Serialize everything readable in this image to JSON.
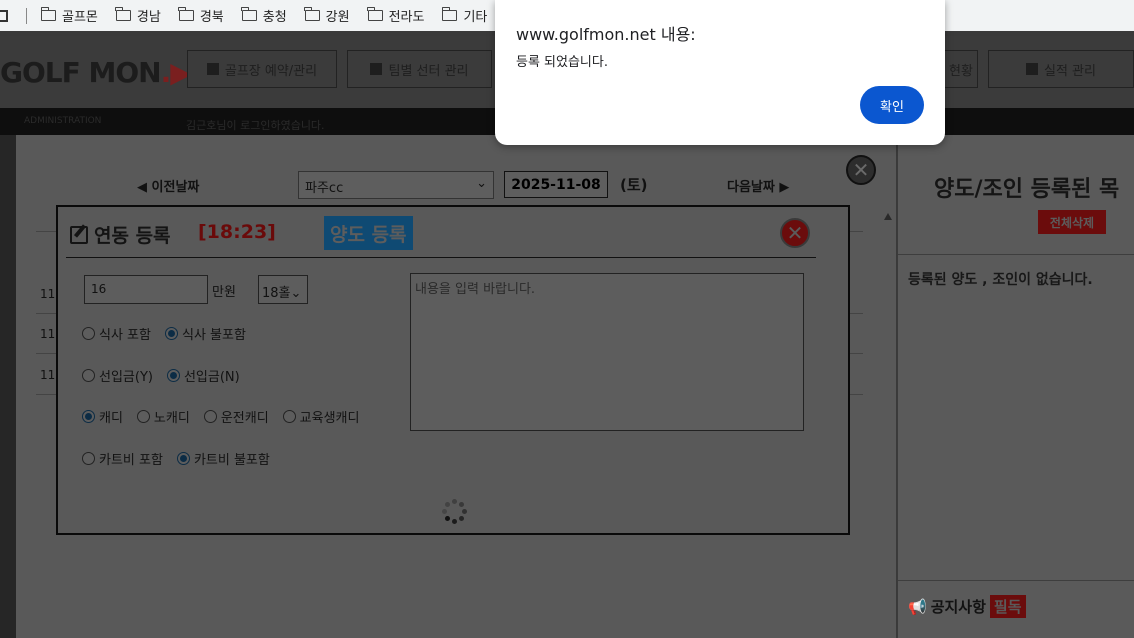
{
  "bookmarks": {
    "items": [
      "골프몬",
      "경남",
      "경북",
      "충청",
      "강원",
      "전라도",
      "기타"
    ]
  },
  "site": {
    "logo": "GOLF MON",
    "nav": [
      "골프장 예약/관리",
      "팀별 선터 관리",
      "현황",
      "실적 관리"
    ],
    "admin_label": "ADMINISTRATION",
    "login_text": "김근호님이 로그인하였습니다."
  },
  "panel": {
    "prev_label": "이전날짜",
    "course": "파주cc",
    "date": "2025-11-08",
    "weekday": "(토)",
    "next_label": "다음날짜",
    "rows": [
      "11",
      "11",
      "11"
    ]
  },
  "right_panel": {
    "title": "양도/조인 등록된 목",
    "delete_all": "전체삭제",
    "empty_text": "등록된 양도 , 조인이 없습니다.",
    "notice_label": "공지사항",
    "notice_badge": "필독"
  },
  "modal": {
    "title": "연동 등록",
    "time": "[18:23]",
    "tag": "양도 등록",
    "price_value": "16",
    "price_unit": "만원",
    "hole_option": "18홀",
    "meal": [
      "식사 포함",
      "식사 불포함"
    ],
    "deposit": [
      "선입금(Y)",
      "선입금(N)"
    ],
    "caddy": [
      "캐디",
      "노캐디",
      "운전캐디",
      "교육생캐디"
    ],
    "cart": [
      "카트비 포함",
      "카트비 불포함"
    ],
    "memo_placeholder": "내용을 입력 바랍니다."
  },
  "dialog": {
    "origin": "www.golfmon.net 내용:",
    "message": "등록 되었습니다.",
    "ok_label": "확인"
  },
  "colors": {
    "dialog_button": "#0b57d0",
    "time_red": "#cc1111",
    "tag_blue": "#1e90e0"
  }
}
